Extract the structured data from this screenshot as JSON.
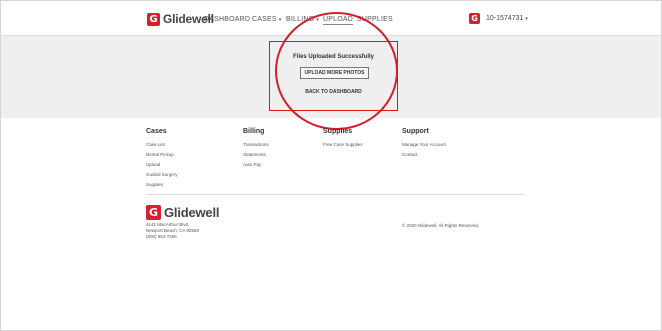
{
  "brand": {
    "logo_letter": "G",
    "name": "Glidewell"
  },
  "nav": {
    "items": [
      {
        "label": "DASHBOARD",
        "caret": ""
      },
      {
        "label": "CASES",
        "caret": "▾"
      },
      {
        "label": "BILLING",
        "caret": "▾"
      },
      {
        "label": "UPLOAD",
        "caret": ""
      },
      {
        "label": "SUPPLIES",
        "caret": ""
      }
    ],
    "account": {
      "logo_letter": "G",
      "number": "10-1574731",
      "caret": "▾"
    }
  },
  "main": {
    "success_title": "Files Uploaded Successfully",
    "upload_more_label": "UPLOAD MORE PHOTOS",
    "back_label": "BACK TO DASHBOARD"
  },
  "annotation": {
    "color": "#d1202a"
  },
  "footer": {
    "columns": [
      {
        "heading": "Cases",
        "links": [
          "Case List",
          "Dental Pickup",
          "Upload",
          "Guided Surgery",
          "Supplies"
        ]
      },
      {
        "heading": "Billing",
        "links": [
          "Transactions",
          "Statements",
          "Auto Pay"
        ]
      },
      {
        "heading": "Supplies",
        "links": [
          "Free Case Supplies"
        ]
      },
      {
        "heading": "Support",
        "links": [
          "Manage Your Account",
          "Contact"
        ]
      }
    ],
    "logo_letter": "G",
    "logo_name": "Glidewell",
    "address_lines": [
      "4141 MacArthur Blvd.",
      "Newport Beach, CA 92660",
      "(800) 854-7256"
    ],
    "copyright": "© 2020 Glidewell. All Rights Reserved."
  },
  "colors": {
    "brand_red": "#d7202c",
    "band_grey": "#efefef",
    "box_border": "#e0161c"
  }
}
